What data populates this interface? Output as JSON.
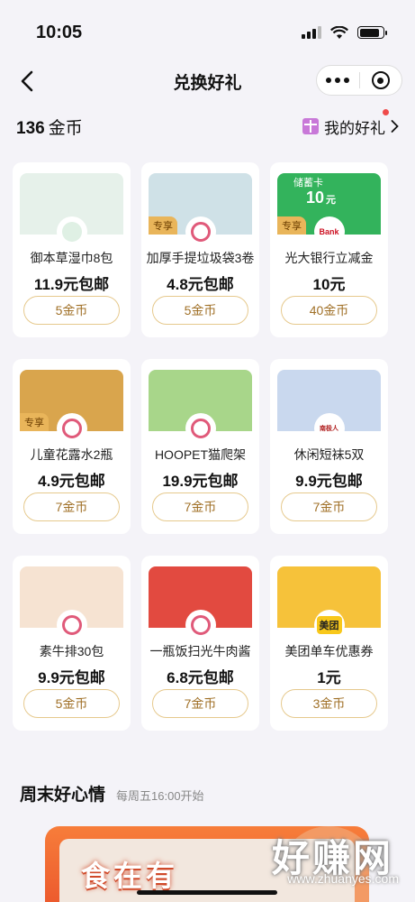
{
  "status": {
    "time": "10:05"
  },
  "nav": {
    "title": "兑换好礼"
  },
  "coins": {
    "count": "136",
    "unit": "金币"
  },
  "my_gifts": {
    "label": "我的好礼"
  },
  "tag_label": "专享",
  "products": [
    {
      "name": "御本草湿巾8包",
      "price": "11.9元包邮",
      "cost": "5金币",
      "tag": false,
      "thumb_color": "#e6f1ea",
      "logo": "brand"
    },
    {
      "name": "加厚手提垃圾袋3卷",
      "price": "4.8元包邮",
      "cost": "5金币",
      "tag": true,
      "thumb_color": "#cfe1e7",
      "logo": "app"
    },
    {
      "name": "光大银行立减金",
      "price": "10元",
      "cost": "40金币",
      "tag": true,
      "thumb_color": "#33b35c",
      "logo": "bank",
      "thumb_text": "储蓄卡",
      "thumb_amount": "10",
      "thumb_amount_unit": "元",
      "logo_text": "Bank"
    },
    {
      "name": "儿童花露水2瓶",
      "price": "4.9元包邮",
      "cost": "7金币",
      "tag": true,
      "thumb_color": "#d9a54d",
      "logo": "app"
    },
    {
      "name": "HOOPET猫爬架",
      "price": "19.9元包邮",
      "cost": "7金币",
      "tag": false,
      "thumb_color": "#a8d68a",
      "logo": "app"
    },
    {
      "name": "休闲短袜5双",
      "price": "9.9元包邮",
      "cost": "7金币",
      "tag": false,
      "thumb_color": "#c9d8ee",
      "logo": "nanjiren",
      "logo_text": "南极人"
    },
    {
      "name": "素牛排30包",
      "price": "9.9元包邮",
      "cost": "5金币",
      "tag": false,
      "thumb_color": "#f6e3d2",
      "logo": "app"
    },
    {
      "name": "一瓶饭扫光牛肉酱",
      "price": "6.8元包邮",
      "cost": "7金币",
      "tag": false,
      "thumb_color": "#e24a40",
      "logo": "app"
    },
    {
      "name": "美团单车优惠券",
      "price": "1元",
      "cost": "3金币",
      "tag": false,
      "thumb_color": "#f6c23a",
      "logo": "meituan",
      "logo_text": "美团"
    }
  ],
  "section": {
    "title": "周末好心情",
    "subtitle": "每周五16:00开始"
  },
  "banner": {
    "text": "食在有"
  },
  "watermark": {
    "text": "好赚网",
    "url": "www.zhuanyes.com"
  },
  "colors": {
    "accent": "#a07027",
    "button_border": "#e6c98d",
    "tag_bg": "#e9b55a",
    "background": "#f4f3f8"
  }
}
